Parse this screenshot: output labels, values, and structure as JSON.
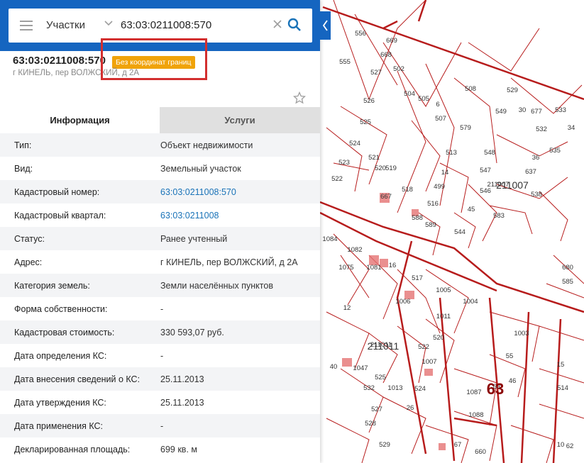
{
  "search": {
    "type_label": "Участки",
    "query": "63:03:0211008:570"
  },
  "object": {
    "title": "63:03:0211008:570",
    "badge": "Без координат границ",
    "address": "г КИНЕЛЬ, пер ВОЛЖСКИЙ, д 2А"
  },
  "tabs": {
    "info": "Информация",
    "services": "Услуги"
  },
  "properties": [
    {
      "label": "Тип:",
      "value": "Объект недвижимости"
    },
    {
      "label": "Вид:",
      "value": "Земельный участок"
    },
    {
      "label": "Кадастровый номер:",
      "value": "63:03:0211008:570"
    },
    {
      "label": "Кадастровый квартал:",
      "value": "63:03:0211008"
    },
    {
      "label": "Статус:",
      "value": "Ранее учтенный"
    },
    {
      "label": "Адрес:",
      "value": "г КИНЕЛЬ, пер ВОЛЖСКИЙ, д 2А"
    },
    {
      "label": "Категория земель:",
      "value": "Земли населённых пунктов"
    },
    {
      "label": "Форма собственности:",
      "value": "-"
    },
    {
      "label": "Кадастровая стоимость:",
      "value": "330 593,07 руб."
    },
    {
      "label": "Дата определения КС:",
      "value": "-"
    },
    {
      "label": "Дата внесения сведений о КС:",
      "value": "25.11.2013"
    },
    {
      "label": "Дата утверждения КС:",
      "value": "25.11.2013"
    },
    {
      "label": "Дата применения КС:",
      "value": "-"
    },
    {
      "label": "Декларированная площадь:",
      "value": "699 кв. м"
    }
  ],
  "map": {
    "quarter_labels": [
      "211007",
      "211011",
      "63"
    ],
    "parcel_labels": [
      "556",
      "555",
      "669",
      "668",
      "527",
      "502",
      "526",
      "504",
      "505",
      "508",
      "529",
      "6",
      "549",
      "30",
      "677",
      "533",
      "525",
      "579",
      "507",
      "532",
      "34",
      "524",
      "513",
      "548",
      "36",
      "535",
      "523",
      "521",
      "520",
      "519",
      "14",
      "547",
      "637",
      "522",
      "499",
      "211007",
      "546",
      "538",
      "667",
      "516",
      "518",
      "45",
      "583",
      "588",
      "589",
      "544",
      "680",
      "1084",
      "1082",
      "1075",
      "1081",
      "16",
      "517",
      "1005",
      "585",
      "1006",
      "1004",
      "1011",
      "12",
      "211011",
      "520",
      "522",
      "1007",
      "1003",
      "55",
      "40",
      "1047",
      "525",
      "1013",
      "524",
      "46",
      "15",
      "532",
      "63",
      "514",
      "1087",
      "527",
      "26",
      "1088",
      "528",
      "529",
      "67",
      "660",
      "10",
      "62"
    ],
    "accent_color": "#b71c1c",
    "topbar_color": "#1565c0",
    "badge_color": "#f0a30a"
  }
}
